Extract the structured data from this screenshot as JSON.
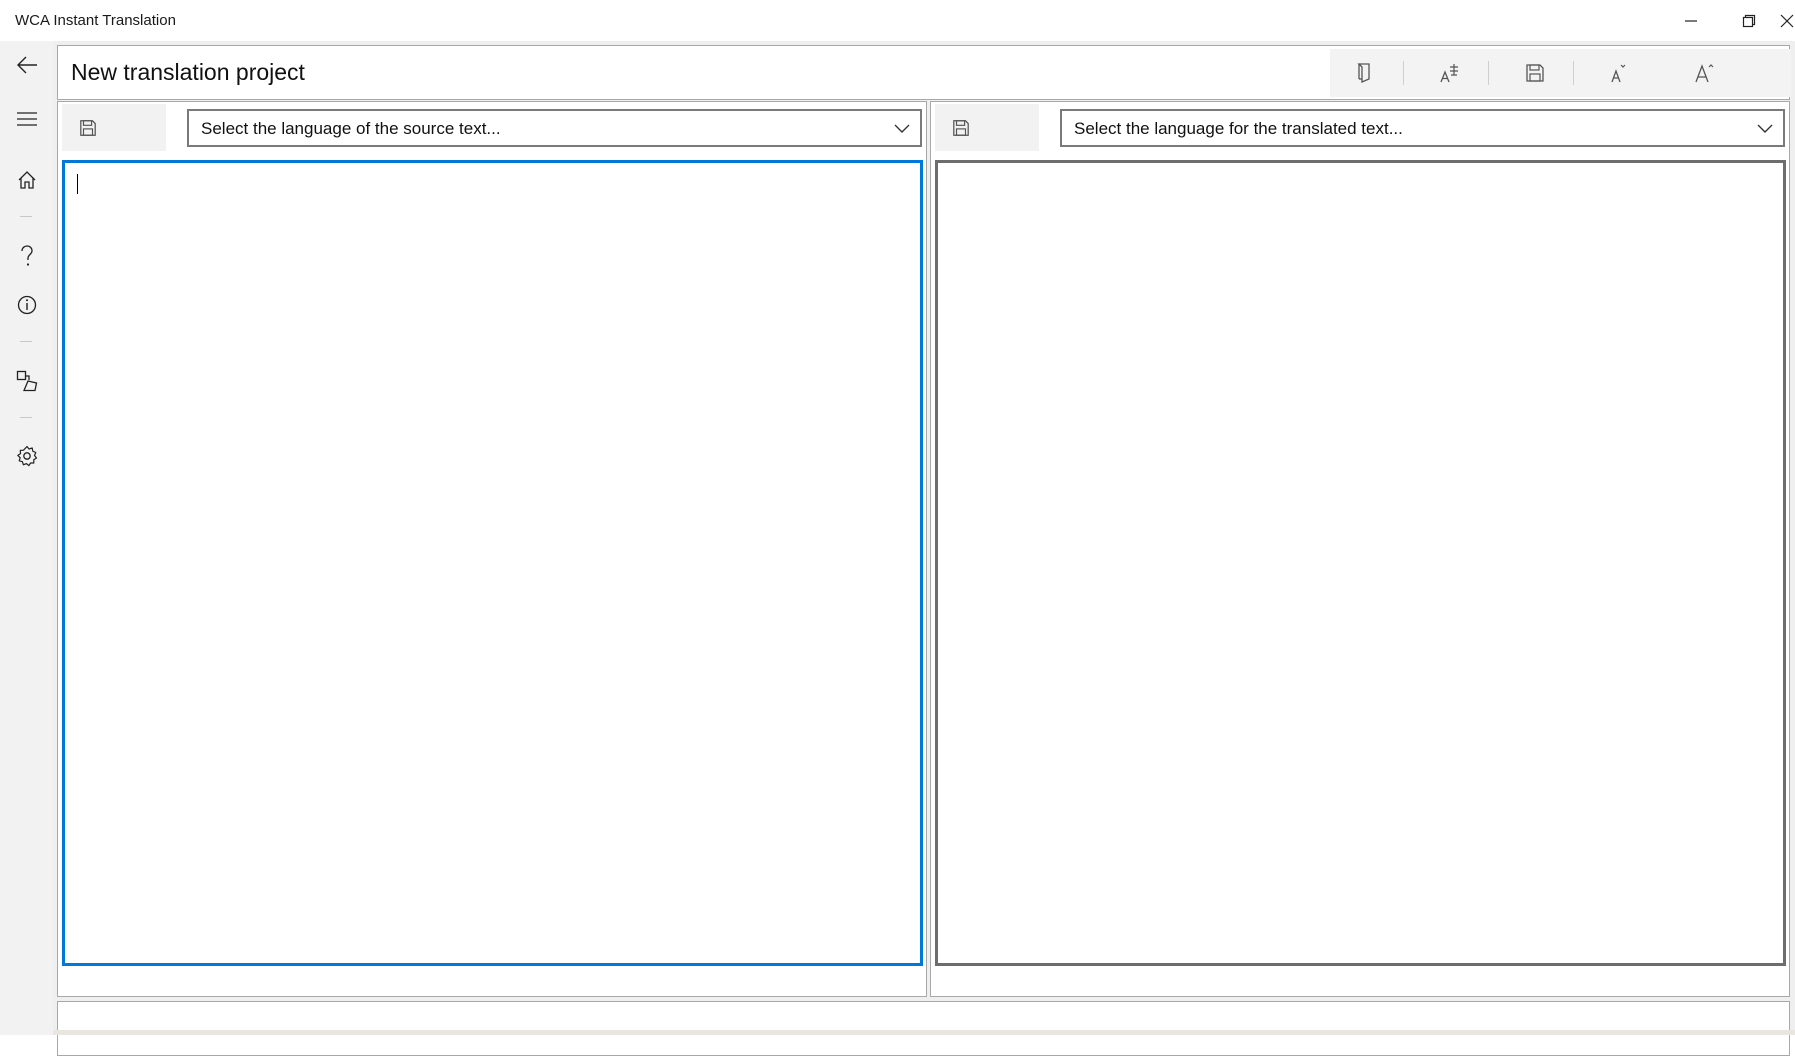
{
  "window": {
    "title": "WCA Instant Translation",
    "controls": [
      "minimize-icon",
      "restore-icon",
      "close-icon"
    ]
  },
  "nav": {
    "items": [
      {
        "name": "back",
        "icon": "back-arrow-icon"
      },
      {
        "name": "menu",
        "icon": "hamburger-icon"
      },
      {
        "name": "home",
        "icon": "home-icon"
      },
      {
        "name": "help",
        "icon": "question-icon"
      },
      {
        "name": "info",
        "icon": "info-icon"
      },
      {
        "name": "shapes",
        "icon": "shapes-icon"
      },
      {
        "name": "settings",
        "icon": "gear-icon"
      }
    ]
  },
  "header": {
    "title": "New translation project",
    "toolbar": [
      {
        "name": "open",
        "icon": "book-open-icon"
      },
      {
        "name": "font-style",
        "icon": "font-strikethrough-icon"
      },
      {
        "name": "save",
        "icon": "save-icon"
      },
      {
        "name": "font-decrease",
        "icon": "font-decrease-icon"
      },
      {
        "name": "font-increase",
        "icon": "font-increase-icon"
      }
    ]
  },
  "source": {
    "save_icon": "save-icon",
    "language_placeholder": "Select the language of the source text...",
    "text": ""
  },
  "target": {
    "save_icon": "save-icon",
    "language_placeholder": "Select the language for the translated text...",
    "text": ""
  },
  "status": {
    "text": ""
  },
  "colors": {
    "accent": "#0078d7",
    "nav_background": "#f2f2f2",
    "border": "#a8a8a8"
  }
}
